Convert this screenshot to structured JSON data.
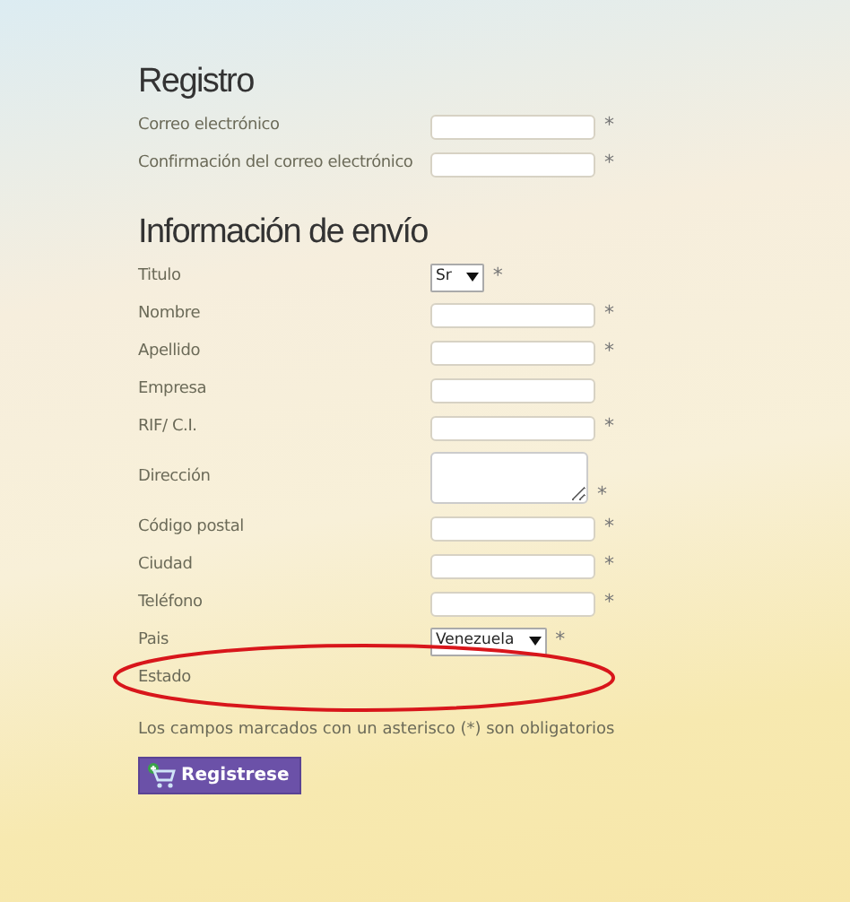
{
  "sections": [
    {
      "title": "Registro",
      "fields": [
        {
          "label": "Correo electrónico",
          "kind": "text",
          "required": true
        },
        {
          "label": "Confirmación del correo electrónico",
          "kind": "text",
          "required": true
        }
      ]
    },
    {
      "title": "Información de envío",
      "fields": [
        {
          "label": "Titulo",
          "kind": "select",
          "value": "Sr",
          "required": true
        },
        {
          "label": "Nombre",
          "kind": "text",
          "required": true
        },
        {
          "label": "Apellido",
          "kind": "text",
          "required": true
        },
        {
          "label": "Empresa",
          "kind": "text",
          "required": false
        },
        {
          "label": "RIF/ C.I.",
          "kind": "text",
          "required": true
        },
        {
          "label": "Dirección",
          "kind": "textarea",
          "required": true
        },
        {
          "label": "Código postal",
          "kind": "text",
          "required": true
        },
        {
          "label": "Ciudad",
          "kind": "text",
          "required": true
        },
        {
          "label": "Teléfono",
          "kind": "text",
          "required": true
        },
        {
          "label": "Pais",
          "kind": "select",
          "value": "Venezuela",
          "required": true
        },
        {
          "label": "Estado",
          "kind": "none",
          "required": false,
          "highlighted": true
        }
      ]
    }
  ],
  "required_mark": "*",
  "note": "Los campos marcados con un asterisco (*) son obligatorios",
  "submit_button": "Registrese"
}
